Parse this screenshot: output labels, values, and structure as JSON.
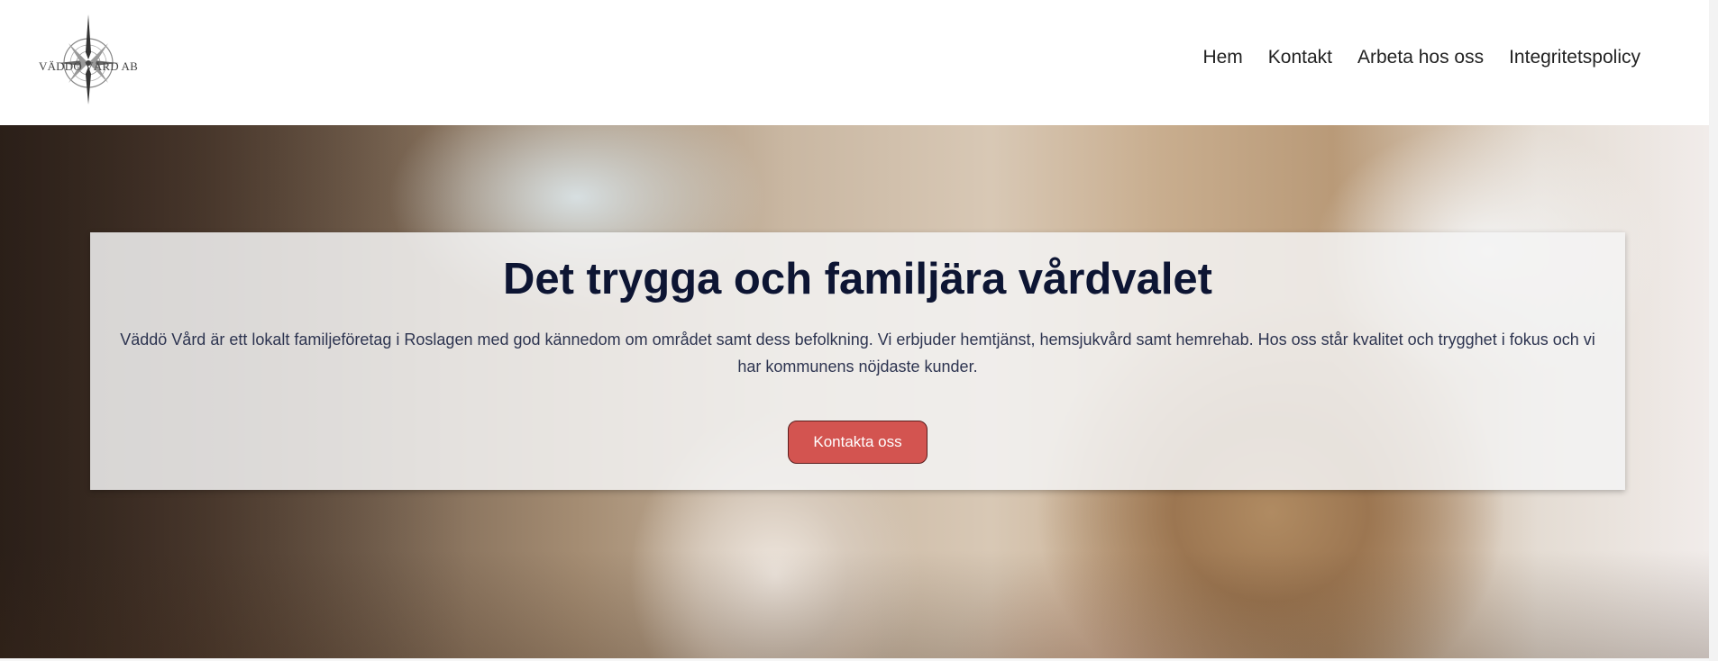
{
  "header": {
    "logo_text": "VÄDDÖ VÅRD AB",
    "logo_icon": "compass-icon",
    "nav": [
      {
        "label": "Hem"
      },
      {
        "label": "Kontakt"
      },
      {
        "label": "Arbeta hos oss"
      },
      {
        "label": "Integritetspolicy"
      }
    ]
  },
  "hero": {
    "title": "Det trygga och familjära vårdvalet",
    "description": "Väddö Vård är ett lokalt familjeföretag i Roslagen med god kännedom om området samt dess befolkning. Vi erbjuder hemtjänst, hemsjukvård samt hemrehab. Hos oss står kvalitet och trygghet i fokus och vi har kommunens nöjdaste kunder.",
    "cta_label": "Kontakta oss"
  },
  "colors": {
    "title": "#0d1533",
    "cta_background": "#d35450",
    "cta_text": "#ffffff"
  }
}
